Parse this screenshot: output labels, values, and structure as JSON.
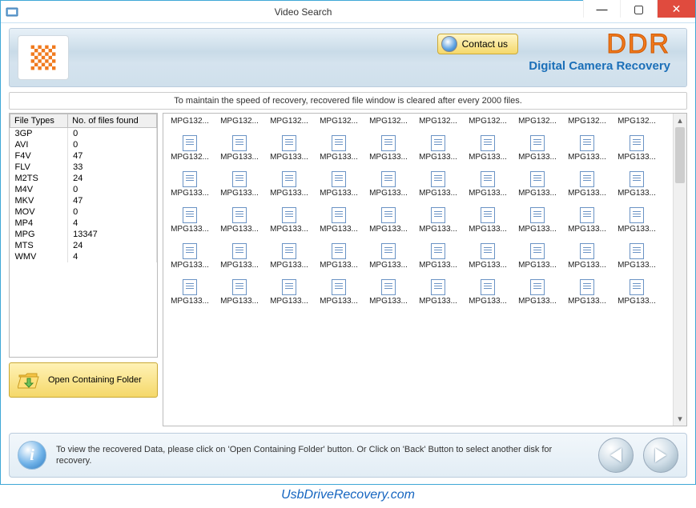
{
  "window": {
    "title": "Video Search"
  },
  "banner": {
    "contact_label": "Contact us",
    "brand": "DDR",
    "brand_sub": "Digital Camera Recovery"
  },
  "notice": "To maintain the speed of recovery, recovered file window is cleared after every 2000 files.",
  "table": {
    "headers": [
      "File Types",
      "No. of files found"
    ],
    "rows": [
      {
        "type": "3GP",
        "count": "0"
      },
      {
        "type": "AVI",
        "count": "0"
      },
      {
        "type": "F4V",
        "count": "47"
      },
      {
        "type": "FLV",
        "count": "33"
      },
      {
        "type": "M2TS",
        "count": "24"
      },
      {
        "type": "M4V",
        "count": "0"
      },
      {
        "type": "MKV",
        "count": "47"
      },
      {
        "type": "MOV",
        "count": "0"
      },
      {
        "type": "MP4",
        "count": "4"
      },
      {
        "type": "MPG",
        "count": "13347"
      },
      {
        "type": "MTS",
        "count": "24"
      },
      {
        "type": "WMV",
        "count": "4"
      }
    ]
  },
  "open_folder_label": "Open Containing Folder",
  "files": {
    "row_labels": [
      [
        "MPG132...",
        "MPG132...",
        "MPG132...",
        "MPG132...",
        "MPG132...",
        "MPG132...",
        "MPG132...",
        "MPG132...",
        "MPG132...",
        "MPG132..."
      ],
      [
        "MPG132...",
        "MPG133...",
        "MPG133...",
        "MPG133...",
        "MPG133...",
        "MPG133...",
        "MPG133...",
        "MPG133...",
        "MPG133...",
        "MPG133..."
      ],
      [
        "MPG133...",
        "MPG133...",
        "MPG133...",
        "MPG133...",
        "MPG133...",
        "MPG133...",
        "MPG133...",
        "MPG133...",
        "MPG133...",
        "MPG133..."
      ],
      [
        "MPG133...",
        "MPG133...",
        "MPG133...",
        "MPG133...",
        "MPG133...",
        "MPG133...",
        "MPG133...",
        "MPG133...",
        "MPG133...",
        "MPG133..."
      ],
      [
        "MPG133...",
        "MPG133...",
        "MPG133...",
        "MPG133...",
        "MPG133...",
        "MPG133...",
        "MPG133...",
        "MPG133...",
        "MPG133...",
        "MPG133..."
      ],
      [
        "MPG133...",
        "MPG133...",
        "MPG133...",
        "MPG133...",
        "MPG133...",
        "MPG133...",
        "MPG133...",
        "MPG133...",
        "MPG133...",
        "MPG133..."
      ]
    ]
  },
  "footer": {
    "message": "To view the recovered Data, please click on 'Open Containing Folder' button. Or Click on 'Back' Button to select another disk for recovery."
  },
  "site_link": "UsbDriveRecovery.com"
}
